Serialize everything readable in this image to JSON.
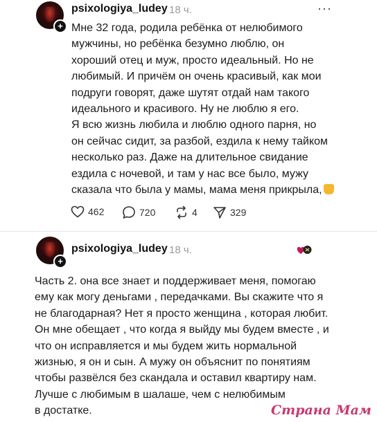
{
  "post1": {
    "username": "psixologiya_ludey",
    "time": "18 ч.",
    "more": "···",
    "lines": [
      "Мне 32 года, родила ребёнка от нелюбимого",
      "мужчины, но ребёнка безумно люблю, он",
      "хороший отец и муж, просто идеальный.  Но не",
      "любимый. И причём он очень красивый, как мои",
      "подруги говорят, даже шутят отдай нам такого",
      "идеального и красивого. Ну не люблю я его.",
      "Я всю жизнь любила и люблю одного парня, но",
      "он сейчас сидит, за разбой, ездила к нему тайком",
      "несколько раз. Даже на длительное свидание",
      "ездила с ночевой, и там у нас все было, мужу",
      "сказала что была у мамы, мама меня прикрыла,"
    ],
    "likes": "462",
    "comments": "720",
    "reposts": "4",
    "shares": "329"
  },
  "post2": {
    "username": "psixologiya_ludey",
    "time": "18 ч.",
    "lines": [
      "Часть 2. она все знает и поддерживает меня, помогаю",
      "ему как могу деньгами , передачками. Вы скажите что я",
      "не благодарная? Нет я просто женщина , которая любит.",
      "Он мне обещает , что когда я выйду мы будем вместе , и",
      "что он исправляется и мы будем жить нормальной",
      "жизнью, я он и сын. А мужу он объяснит по понятиям",
      "чтобы развёлся без скандала и оставил квартиру нам.",
      "Лучше с любимым в шалаше, чем с нелюбимым",
      "в достатке."
    ]
  },
  "watermark": "Страна Мам",
  "colors": {
    "watermark": "#c73a70",
    "timestamp": "#9a9a9a"
  }
}
